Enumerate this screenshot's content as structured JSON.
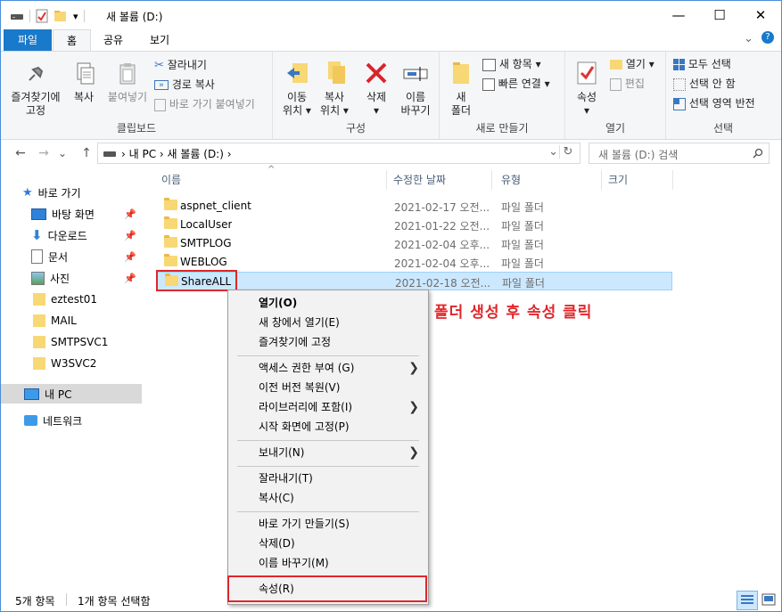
{
  "window": {
    "title": "새 볼륨 (D:)",
    "minimize_glyph": "—",
    "maximize_glyph": "☐",
    "close_glyph": "✕"
  },
  "quick_access": {
    "dropdown_glyph": "▾"
  },
  "ribbon_tabs": [
    {
      "label": "파일"
    },
    {
      "label": "홈"
    },
    {
      "label": "공유"
    },
    {
      "label": "보기"
    }
  ],
  "ribbon_help": {
    "expand_glyph": "⌄",
    "help_glyph": "?"
  },
  "ribbon": {
    "clipboard": {
      "label": "클립보드",
      "pin_label": "즐겨찾기에\n고정",
      "copy_label": "복사",
      "paste_label": "붙여넣기",
      "cut_label": "잘라내기",
      "copy_path_label": "경로 복사",
      "paste_shortcut_label": "바로 가기 붙여넣기"
    },
    "organize": {
      "label": "구성",
      "move_label": "이동\n위치 ▾",
      "copyto_label": "복사\n위치 ▾",
      "delete_label": "삭제\n▾",
      "rename_label": "이름\n바꾸기"
    },
    "new": {
      "label": "새로 만들기",
      "folder_label": "새\n폴더",
      "new_item_label": "새 항목 ▾",
      "easy_access_label": "빠른 연결 ▾"
    },
    "open": {
      "label": "열기",
      "properties_label": "속성\n▾",
      "open_label": "열기 ▾",
      "edit_label": "편집"
    },
    "select": {
      "label": "선택",
      "select_all_label": "모두 선택",
      "select_none_label": "선택 안 함",
      "invert_label": "선택 영역 반전"
    }
  },
  "nav_buttons": {
    "back": "←",
    "forward": "→",
    "recent": "⌄",
    "up": "↑"
  },
  "address": {
    "path": "›  내 PC  ›  새 볼륨 (D:)  ›",
    "dropdown_glyph": "⌄",
    "refresh_glyph": "↻"
  },
  "search": {
    "placeholder": "새 볼륨 (D:) 검색",
    "icon": "search-icon"
  },
  "nav_pane": {
    "quick_access": "바로 가기",
    "items": [
      {
        "label": "바탕 화면",
        "pinned": true
      },
      {
        "label": "다운로드",
        "pinned": true
      },
      {
        "label": "문서",
        "pinned": true
      },
      {
        "label": "사진",
        "pinned": true
      },
      {
        "label": "eztest01"
      },
      {
        "label": "MAIL"
      },
      {
        "label": "SMTPSVC1"
      },
      {
        "label": "W3SVC2"
      }
    ],
    "this_pc": "내 PC",
    "network": "네트워크"
  },
  "columns": {
    "name": "이름",
    "modified": "수정한 날짜",
    "type": "유형",
    "size": "크기",
    "sort_glyph": "^"
  },
  "files": [
    {
      "name": "aspnet_client",
      "modified": "2021-02-17 오전...",
      "type": "파일 폴더"
    },
    {
      "name": "LocalUser",
      "modified": "2021-01-22 오전...",
      "type": "파일 폴더"
    },
    {
      "name": "SMTPLOG",
      "modified": "2021-02-04 오후...",
      "type": "파일 폴더"
    },
    {
      "name": "WEBLOG",
      "modified": "2021-02-04 오후...",
      "type": "파일 폴더"
    },
    {
      "name": "ShareALL",
      "modified": "2021-02-18 오전...",
      "type": "파일 폴더"
    }
  ],
  "annotation": "폴더 생성 후 속성 클릭",
  "context_menu": {
    "open": "열기(O)",
    "open_new_window": "새 창에서 열기(E)",
    "pin_quick": "즐겨찾기에 고정",
    "give_access": "액세스 권한 부여 (G)",
    "restore_versions": "이전 버전 복원(V)",
    "include_library": "라이브러리에 포함(I)",
    "pin_start": "시작 화면에 고정(P)",
    "send_to": "보내기(N)",
    "cut": "잘라내기(T)",
    "copy": "복사(C)",
    "create_shortcut": "바로 가기 만들기(S)",
    "delete": "삭제(D)",
    "rename": "이름 바꾸기(M)",
    "properties": "속성(R)",
    "submenu_glyph": "❯"
  },
  "status": {
    "count": "5개 항목",
    "selected": "1개 항목 선택함"
  },
  "colors": {
    "accent": "#1979ca",
    "highlight": "#e0262b",
    "selection": "#cce8ff"
  }
}
